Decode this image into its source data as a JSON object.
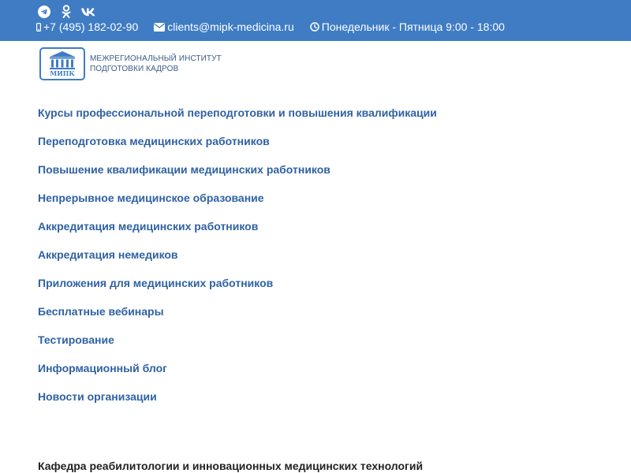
{
  "header": {
    "social": [
      {
        "icon": "telegram-icon"
      },
      {
        "icon": "odnoklassniki-icon"
      },
      {
        "icon": "vk-icon"
      }
    ],
    "phone": "+7 (495) 182-02-90",
    "email": "clients@mipk-medicina.ru",
    "hours": "Понедельник - Пятница 9:00 - 18:00"
  },
  "logo": {
    "abbr": "МИПК",
    "line1": "МЕЖРЕГИОНАЛЬНЫЙ ИНСТИТУТ",
    "line2": "ПОДГОТОВКИ КАДРОВ"
  },
  "menu": {
    "items": [
      {
        "label": "Курсы профессиональной переподготовки и повышения квалификации"
      },
      {
        "label": "Переподготовка медицинских работников"
      },
      {
        "label": "Повышение квалификации медицинских работников"
      },
      {
        "label": "Непрерывное медицинское образование"
      },
      {
        "label": "Аккредитация медицинских работников"
      },
      {
        "label": "Аккредитация немедиков"
      },
      {
        "label": "Приложения для медицинских работников"
      },
      {
        "label": "Бесплатные вебинары"
      },
      {
        "label": "Тестирование"
      },
      {
        "label": "Информационный блог"
      },
      {
        "label": "Новости организации"
      }
    ]
  },
  "department": {
    "title": "Кафедра реабилитологии и инновационных медицинских технологий"
  },
  "colors": {
    "topbar": "#3f7cc4",
    "menu_link": "#2f62a3",
    "logo_text": "#3c5a86"
  }
}
